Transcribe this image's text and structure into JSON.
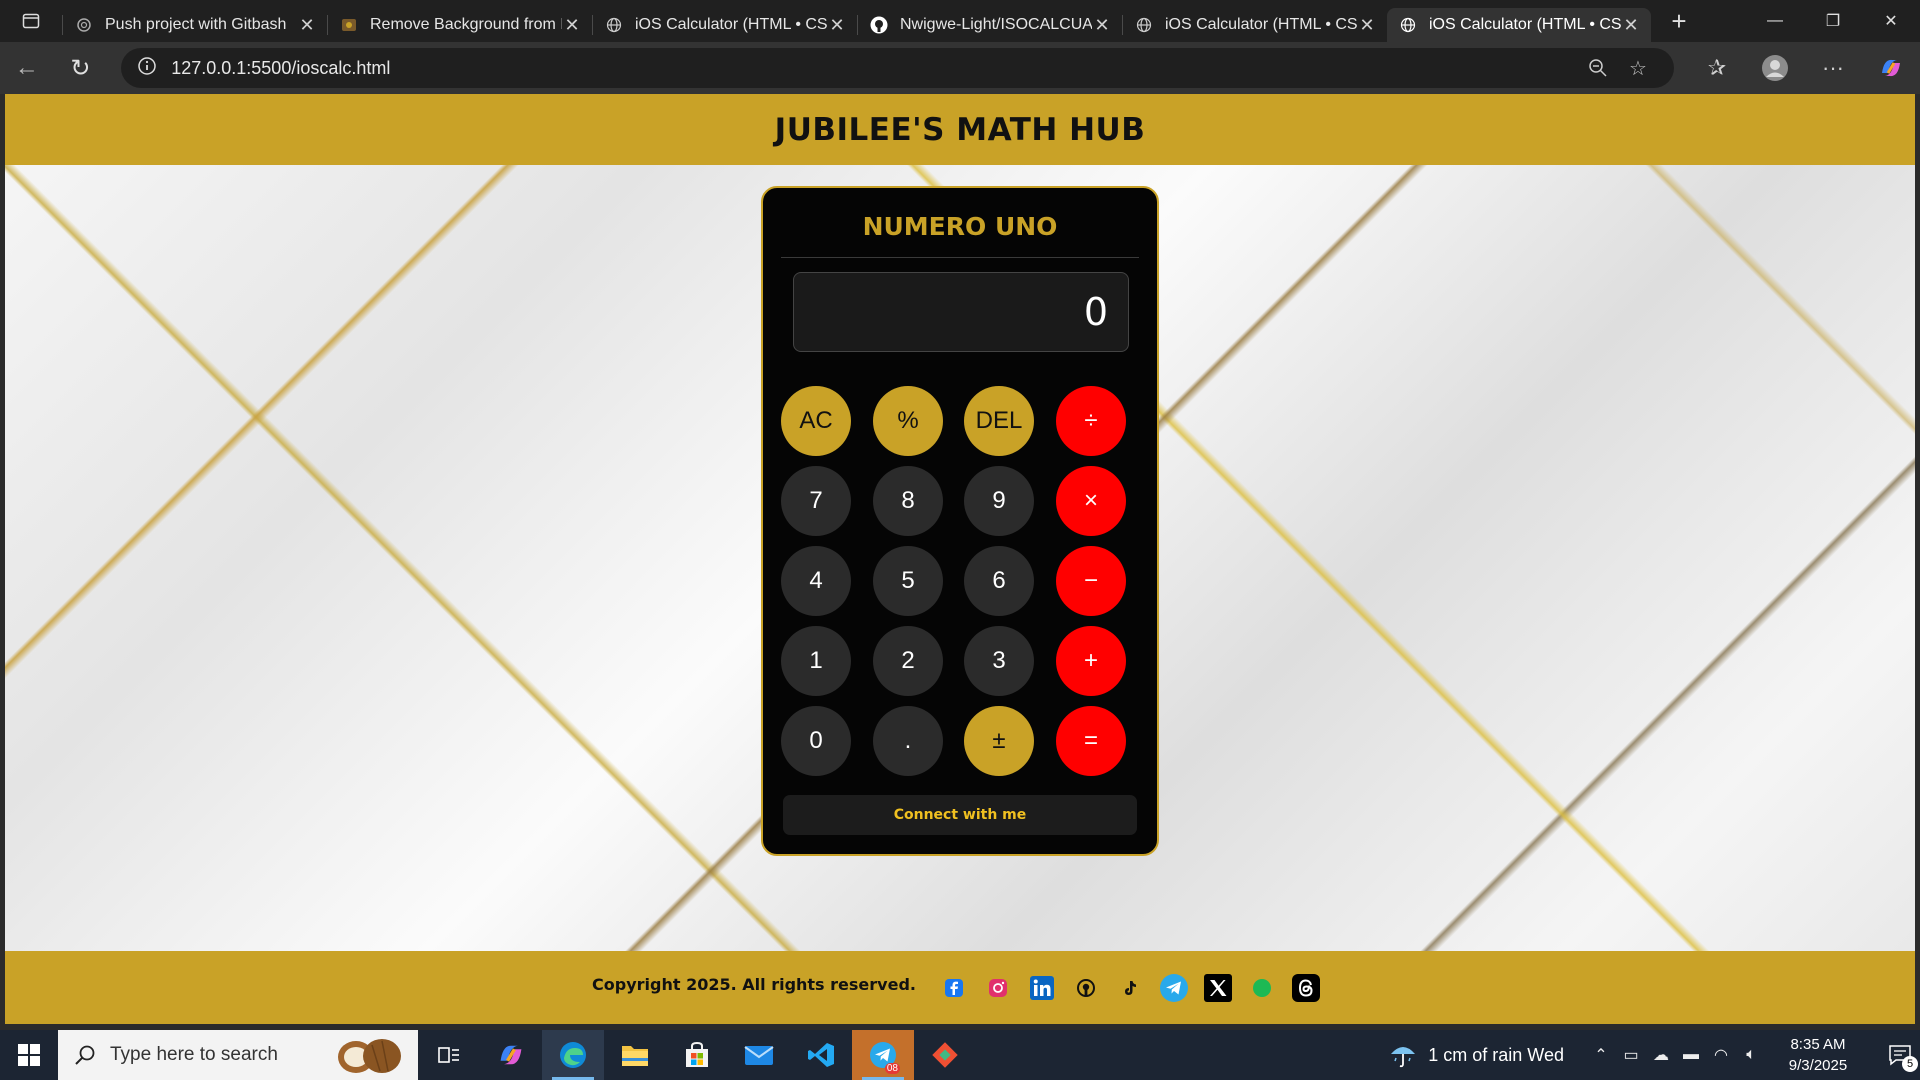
{
  "browser": {
    "tabs": [
      {
        "title": "Push project with Gitbash",
        "icon": "openai-icon"
      },
      {
        "title": "Remove Background from Im",
        "icon": "image-icon"
      },
      {
        "title": "iOS Calculator (HTML • CSS",
        "icon": "globe-icon"
      },
      {
        "title": "Nwigwe-Light/ISOCALCUATO",
        "icon": "github-icon"
      },
      {
        "title": "iOS Calculator (HTML • CSS",
        "icon": "globe-icon"
      },
      {
        "title": "iOS Calculator (HTML • CSS",
        "icon": "globe-icon",
        "active": true
      }
    ],
    "url": "127.0.0.1:5500/ioscalc.html"
  },
  "page": {
    "header_title": "JUBILEE'S MATH HUB",
    "calculator": {
      "title": "NUMERO UNO",
      "display": "0",
      "keys": [
        [
          "AC",
          "%",
          "DEL",
          "÷"
        ],
        [
          "7",
          "8",
          "9",
          "×"
        ],
        [
          "4",
          "5",
          "6",
          "−"
        ],
        [
          "1",
          "2",
          "3",
          "+"
        ],
        [
          "0",
          ".",
          "±",
          "="
        ]
      ],
      "connect_label": "Connect with me"
    },
    "footer": {
      "copyright": "Copyright 2025. All rights reserved.",
      "social_icons": [
        "facebook-icon",
        "instagram-icon",
        "linkedin-icon",
        "github-icon",
        "tiktok-icon",
        "telegram-icon",
        "x-icon",
        "spotify-icon",
        "threads-icon"
      ]
    },
    "colors": {
      "gold": "#c9a227",
      "red": "#ff0000",
      "dark": "#050505"
    }
  },
  "taskbar": {
    "search_placeholder": "Type here to search",
    "weather": "1 cm of rain Wed",
    "time": "8:35 AM",
    "date": "9/3/2025",
    "notification_count": "5",
    "telegram_badge": "08"
  }
}
